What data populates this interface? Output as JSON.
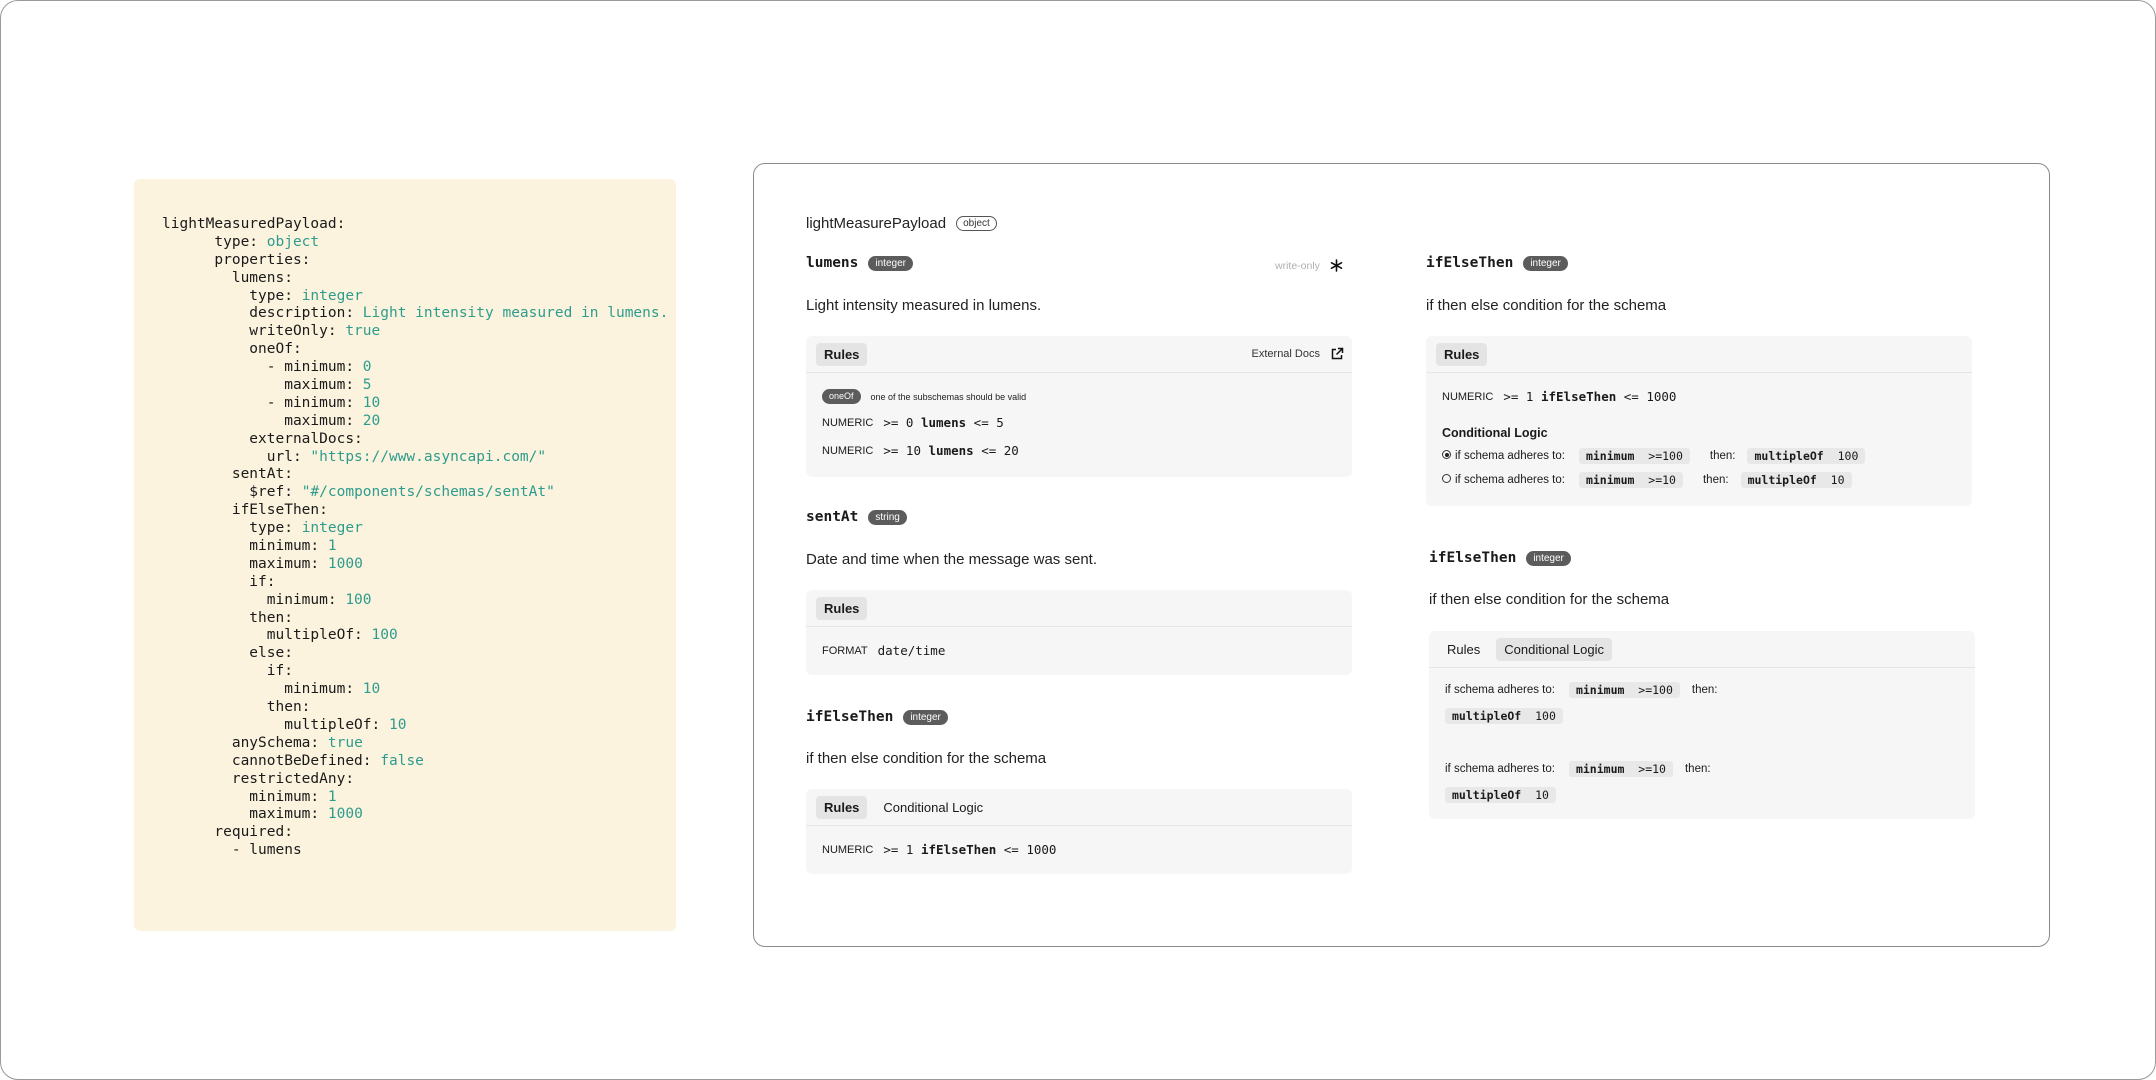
{
  "yaml": [
    [
      {
        "t": "lightMeasuredPayload:"
      }
    ],
    [
      {
        "t": "      type: "
      },
      {
        "t": "object",
        "v": true
      }
    ],
    [
      {
        "t": "      properties:"
      }
    ],
    [
      {
        "t": "        lumens:"
      }
    ],
    [
      {
        "t": "          type: "
      },
      {
        "t": "integer",
        "v": true
      }
    ],
    [
      {
        "t": "          description: "
      },
      {
        "t": "Light intensity measured in lumens.",
        "v": true
      }
    ],
    [
      {
        "t": "          writeOnly: "
      },
      {
        "t": "true",
        "v": true
      }
    ],
    [
      {
        "t": "          oneOf:"
      }
    ],
    [
      {
        "t": "            - minimum: "
      },
      {
        "t": "0",
        "v": true
      }
    ],
    [
      {
        "t": "              maximum: "
      },
      {
        "t": "5",
        "v": true
      }
    ],
    [
      {
        "t": "            - minimum: "
      },
      {
        "t": "10",
        "v": true
      }
    ],
    [
      {
        "t": "              maximum: "
      },
      {
        "t": "20",
        "v": true
      }
    ],
    [
      {
        "t": "          externalDocs:"
      }
    ],
    [
      {
        "t": "            url: "
      },
      {
        "t": "\"https://www.asyncapi.com/\"",
        "v": true
      }
    ],
    [
      {
        "t": "        sentAt:"
      }
    ],
    [
      {
        "t": "          $ref: "
      },
      {
        "t": "\"#/components/schemas/sentAt\"",
        "v": true
      }
    ],
    [
      {
        "t": "        ifElseThen:"
      }
    ],
    [
      {
        "t": "          type: "
      },
      {
        "t": "integer",
        "v": true
      }
    ],
    [
      {
        "t": "          minimum: "
      },
      {
        "t": "1",
        "v": true
      }
    ],
    [
      {
        "t": "          maximum: "
      },
      {
        "t": "1000",
        "v": true
      }
    ],
    [
      {
        "t": "          if:"
      }
    ],
    [
      {
        "t": "            minimum: "
      },
      {
        "t": "100",
        "v": true
      }
    ],
    [
      {
        "t": "          then:"
      }
    ],
    [
      {
        "t": "            multipleOf: "
      },
      {
        "t": "100",
        "v": true
      }
    ],
    [
      {
        "t": "          else:"
      }
    ],
    [
      {
        "t": "            if:"
      }
    ],
    [
      {
        "t": "              minimum: "
      },
      {
        "t": "10",
        "v": true
      }
    ],
    [
      {
        "t": "            then:"
      }
    ],
    [
      {
        "t": "              multipleOf: "
      },
      {
        "t": "10",
        "v": true
      }
    ],
    [
      {
        "t": "        anySchema: "
      },
      {
        "t": "true",
        "v": true
      }
    ],
    [
      {
        "t": "        cannotBeDefined: "
      },
      {
        "t": "false",
        "v": true
      }
    ],
    [
      {
        "t": "        restrictedAny:"
      }
    ],
    [
      {
        "t": "          minimum: "
      },
      {
        "t": "1",
        "v": true
      }
    ],
    [
      {
        "t": "          maximum: "
      },
      {
        "t": "1000",
        "v": true
      }
    ],
    [
      {
        "t": "      required:"
      }
    ],
    [
      {
        "t": "        - lumens"
      }
    ]
  ],
  "viewer": {
    "root": {
      "name": "lightMeasurePayload",
      "type": "object"
    },
    "lumens": {
      "name": "lumens",
      "type": "integer",
      "write_only": "write-only",
      "description": "Light intensity measured in lumens.",
      "tab_rules": "Rules",
      "external_docs": "External Docs",
      "oneof_badge": "oneOf",
      "oneof_text": "one of the subschemas should be valid",
      "rule1_label": "NUMERIC",
      "rule1_a": ">= 0",
      "rule1_b": "lumens",
      "rule1_c": "<= 5",
      "rule2_label": "NUMERIC",
      "rule2_a": ">= 10",
      "rule2_b": "lumens",
      "rule2_c": "<= 20"
    },
    "sentAt": {
      "name": "sentAt",
      "type": "string",
      "description": "Date and time when the message was sent.",
      "tab_rules": "Rules",
      "format_label": "FORMAT",
      "format_value": "date/time"
    },
    "ifElseThen1": {
      "name": "ifElseThen",
      "type": "integer",
      "description": "if then else condition for the schema",
      "tab_rules": "Rules",
      "tab_cond": "Conditional Logic",
      "rule_label": "NUMERIC",
      "rule_a": ">= 1",
      "rule_b": "ifElseThen",
      "rule_c": "<= 1000"
    },
    "ifElseThen2": {
      "name": "ifElseThen",
      "type": "integer",
      "description": "if then else condition for the schema",
      "tab_rules": "Rules",
      "rule_label": "NUMERIC",
      "rule_a": ">= 1",
      "rule_b": "ifElseThen",
      "rule_c": "<= 1000",
      "cond_title": "Conditional Logic",
      "c1_text": "if schema adheres to:",
      "c1_chip_k": "minimum",
      "c1_chip_v": ">=100",
      "c1_then": "then:",
      "c1_res_k": "multipleOf",
      "c1_res_v": "100",
      "c2_text": "if schema adheres to:",
      "c2_chip_k": "minimum",
      "c2_chip_v": ">=10",
      "c2_then": "then:",
      "c2_res_k": "multipleOf",
      "c2_res_v": "10"
    },
    "ifElseThen3": {
      "name": "ifElseThen",
      "type": "integer",
      "description": "if then else condition for the schema",
      "tab_rules": "Rules",
      "tab_cond": "Conditional Logic",
      "c1_text": "if schema adheres to:",
      "c1_chip_k": "minimum",
      "c1_chip_v": ">=100",
      "c1_then": "then:",
      "c1_res_k": "multipleOf",
      "c1_res_v": "100",
      "c2_text": "if schema adheres to:",
      "c2_chip_k": "minimum",
      "c2_chip_v": ">=10",
      "c2_then": "then:",
      "c2_res_k": "multipleOf",
      "c2_res_v": "10"
    }
  }
}
